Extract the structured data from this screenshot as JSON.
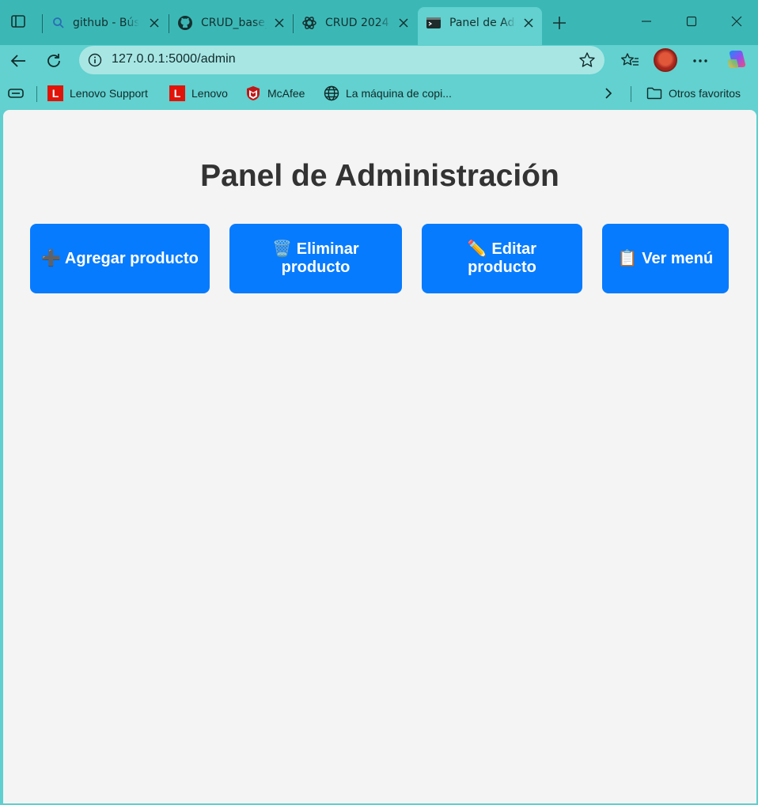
{
  "browser": {
    "tabs": [
      {
        "title": "github - Búsqueda",
        "icon": "search-icon"
      },
      {
        "title": "CRUD_base_",
        "icon": "github-icon"
      },
      {
        "title": "CRUD 2024",
        "icon": "chatgpt-icon"
      },
      {
        "title": "Panel de Administración",
        "icon": "terminal-icon",
        "active": true
      }
    ],
    "address": {
      "url": "127.0.0.1:5000/admin"
    },
    "favorites": [
      {
        "label": "Lenovo Support",
        "icon": "lenovo-icon"
      },
      {
        "label": "Lenovo",
        "icon": "lenovo-icon"
      },
      {
        "label": "McAfee",
        "icon": "mcafee-icon"
      },
      {
        "label": "La máquina de copi...",
        "icon": "globe-icon"
      }
    ],
    "other_favorites": "Otros favoritos",
    "lenovo_letter": "L"
  },
  "page": {
    "title": "Panel de Administración",
    "buttons": [
      {
        "emoji": "➕",
        "label": "Agregar producto"
      },
      {
        "emoji": "🗑️",
        "label": "Eliminar producto"
      },
      {
        "emoji": "✏️",
        "label": "Editar producto"
      },
      {
        "emoji": "📋",
        "label": "Ver menú"
      }
    ],
    "button_color": "#077bfe"
  }
}
